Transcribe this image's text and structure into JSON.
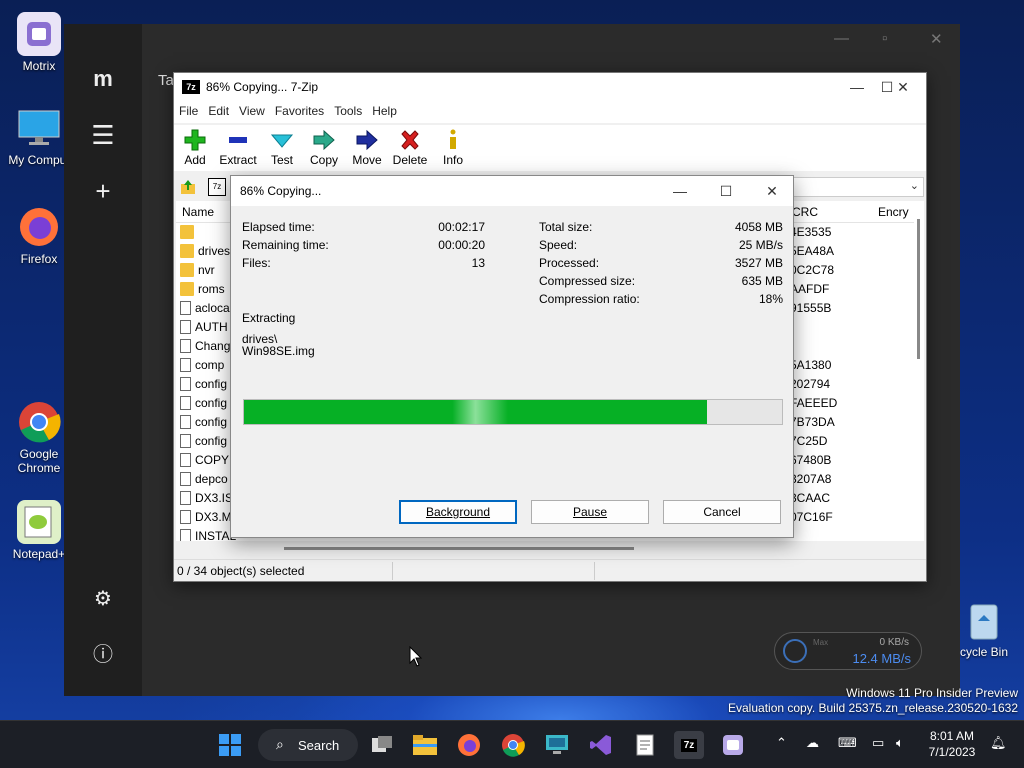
{
  "desktop": {
    "icons": [
      {
        "label": "Motrix"
      },
      {
        "label": "My Comput"
      },
      {
        "label": "Firefox"
      },
      {
        "label": "Google Chrome"
      },
      {
        "label": "Notepad+"
      },
      {
        "label": "cycle Bin"
      }
    ],
    "watermark_line1": "Windows 11 Pro Insider Preview",
    "watermark_line2": "Evaluation copy. Build 25375.zn_release.230520-1632"
  },
  "motrix": {
    "title_partial": "Ta",
    "speed_max_label": "Max",
    "upload_speed": "0 KB/s",
    "download_speed": "12.4 MB/s"
  },
  "zip": {
    "title": "86% Copying... 7-Zip",
    "menu": [
      "File",
      "Edit",
      "View",
      "Favorites",
      "Tools",
      "Help"
    ],
    "toolbar": {
      "add": "Add",
      "extract": "Extract",
      "test": "Test",
      "copy": "Copy",
      "move": "Move",
      "delete": "Delete",
      "info": "Info"
    },
    "columns": {
      "name": "Name",
      "crc": "CRC",
      "encrypted": "Encry"
    },
    "rows": [
      {
        "name": "",
        "crc": "4E3535",
        "type": "folder"
      },
      {
        "name": "drives",
        "crc": "5EA48A",
        "type": "folder"
      },
      {
        "name": "nvr",
        "crc": "0C2C78",
        "type": "folder"
      },
      {
        "name": "roms",
        "crc": "AAFDF",
        "type": "folder"
      },
      {
        "name": "acloca",
        "crc": "91555B",
        "type": "file"
      },
      {
        "name": "AUTH",
        "crc": "",
        "type": "file"
      },
      {
        "name": "Chang",
        "crc": "",
        "type": "file"
      },
      {
        "name": "comp",
        "crc": "5A1380",
        "type": "file"
      },
      {
        "name": "config",
        "crc": "202794",
        "type": "file"
      },
      {
        "name": "config",
        "crc": "FAEEED",
        "type": "file"
      },
      {
        "name": "config",
        "crc": "7B73DA",
        "type": "file"
      },
      {
        "name": "config",
        "crc": "7C25D",
        "type": "file"
      },
      {
        "name": "COPY",
        "crc": "67480B",
        "type": "file"
      },
      {
        "name": "depco",
        "crc": "3207A8",
        "type": "file"
      },
      {
        "name": "DX3.IS",
        "crc": "3CAAC",
        "type": "file"
      },
      {
        "name": "DX3.M",
        "crc": "07C16F",
        "type": "file"
      },
      {
        "name": "INSTAL",
        "crc": "",
        "type": "file"
      }
    ],
    "status": "0 / 34 object(s) selected"
  },
  "dialog": {
    "title": "86% Copying...",
    "elapsed_label": "Elapsed time:",
    "elapsed_value": "00:02:17",
    "remaining_label": "Remaining time:",
    "remaining_value": "00:00:20",
    "files_label": "Files:",
    "files_value": "13",
    "total_label": "Total size:",
    "total_value": "4058 MB",
    "speed_label": "Speed:",
    "speed_value": "25 MB/s",
    "processed_label": "Processed:",
    "processed_value": "3527 MB",
    "compressed_label": "Compressed size:",
    "compressed_value": "635 MB",
    "ratio_label": "Compression ratio:",
    "ratio_value": "18%",
    "operation": "Extracting",
    "path_line1": "drives\\",
    "path_line2": "Win98SE.img",
    "progress_percent": 86,
    "background_button": "Background",
    "pause_button": "Pause",
    "cancel_button": "Cancel"
  },
  "taskbar": {
    "search_label": "Search",
    "time": "8:01 AM",
    "date": "7/1/2023"
  }
}
